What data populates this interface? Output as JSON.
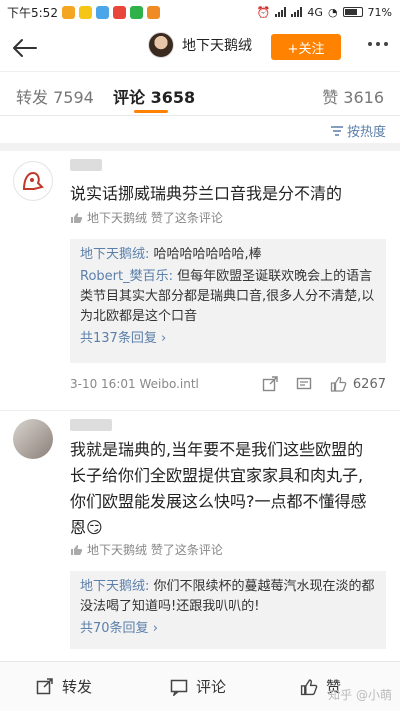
{
  "statusbar": {
    "time": "下午5:52",
    "network": "4G",
    "battery": "71%"
  },
  "nav": {
    "title": "地下天鹅绒",
    "follow_label": "+关注"
  },
  "tabs": {
    "repost": "转发 7594",
    "comment": "评论 3658",
    "like": "赞 3616"
  },
  "sort_label": "按热度",
  "comments": [
    {
      "text": "说实话挪威瑞典芬兰口音我是分不清的",
      "liked_by": "地下天鹅绒 赞了这条评论",
      "replies": [
        {
          "author": "地下天鹅绒:",
          "text": "哈哈哈哈哈哈哈,棒"
        },
        {
          "author": "Robert_樊百乐:",
          "text": "但每年欧盟圣诞联欢晚会上的语言类节目其实大部分都是瑞典口音,很多人分不清楚,以为北欧都是这个口音"
        }
      ],
      "more_replies": "共137条回复",
      "meta": "3-10 16:01  Weibo.intl",
      "likes": "6267"
    },
    {
      "text": "我就是瑞典的,当年要不是我们这些欧盟的长子给你们全欧盟提供宜家家具和肉丸子,你们欧盟能发展这么快吗?一点都不懂得感恩😏",
      "liked_by": "地下天鹅绒 赞了这条评论",
      "replies": [
        {
          "author": "地下天鹅绒:",
          "text": "你们不限续杯的蔓越莓汽水现在淡的都没法喝了知道吗!还跟我叭叭的!"
        }
      ],
      "more_replies": "共70条回复"
    }
  ],
  "toolbar": {
    "repost": "转发",
    "comment": "评论",
    "like": "赞"
  },
  "watermark": "知乎 @小萌"
}
